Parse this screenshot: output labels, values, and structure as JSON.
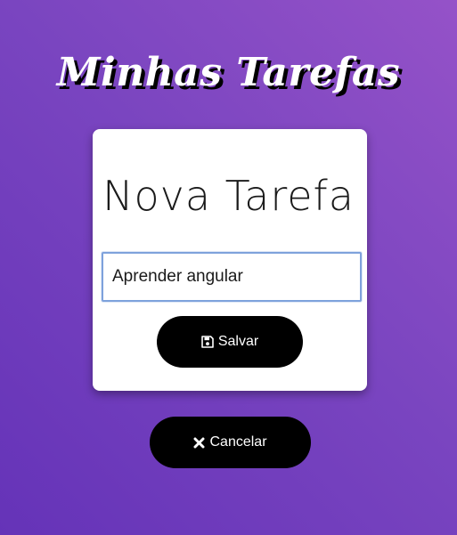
{
  "app": {
    "title": "Minhas Tarefas"
  },
  "card": {
    "title": "Nova Tarefa",
    "input_value": "Aprender angular",
    "save_label": "Salvar",
    "save_icon": "floppy-disk-icon"
  },
  "cancel": {
    "label": "Cancelar",
    "icon": "close-icon"
  },
  "colors": {
    "background_start": "#9552c8",
    "background_end": "#6533b8",
    "button": "#000000",
    "input_border": "#7ea2dc"
  }
}
